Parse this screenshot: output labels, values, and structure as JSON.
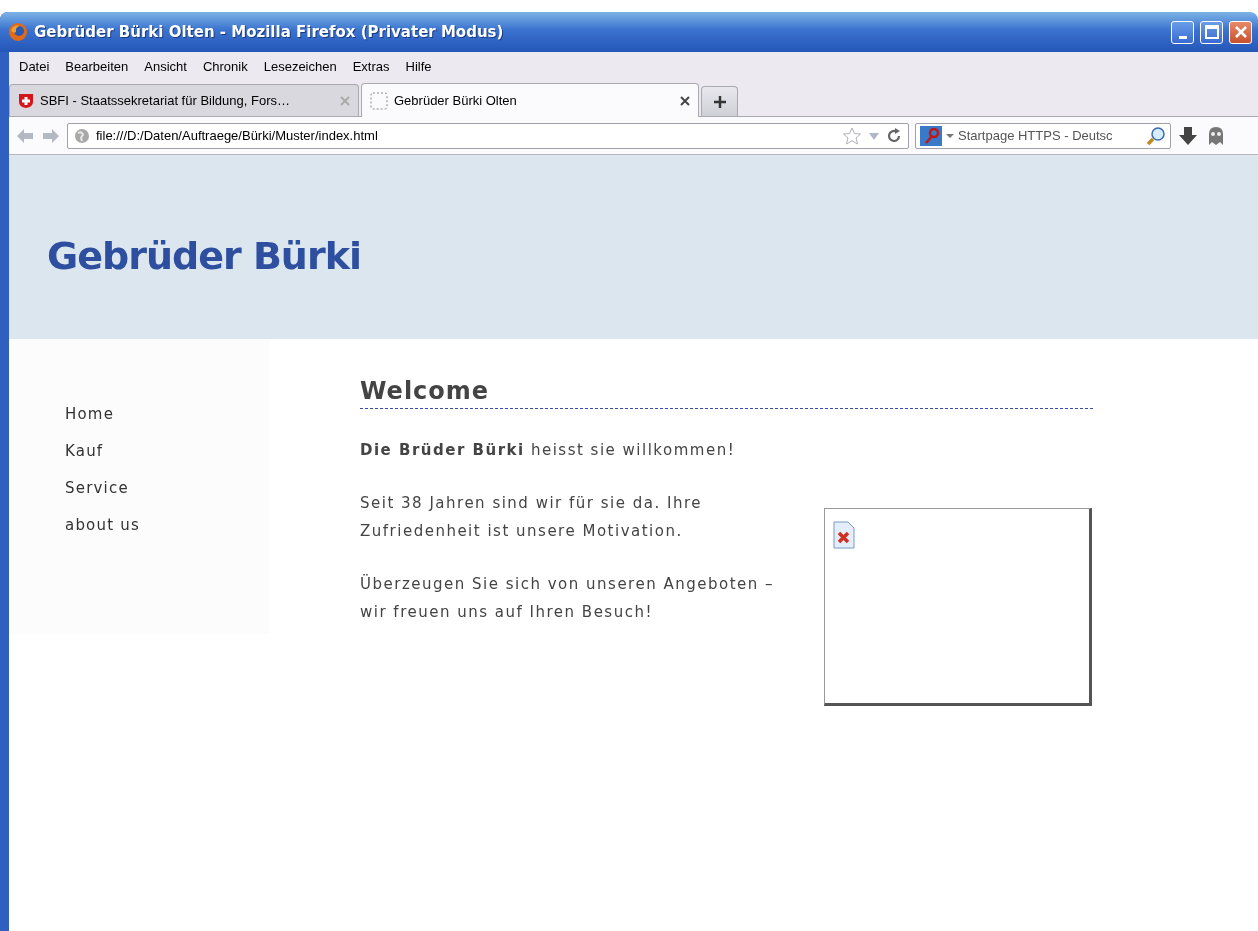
{
  "window": {
    "title": "Gebrüder Bürki Olten - Mozilla Firefox (Privater Modus)"
  },
  "menu": [
    "Datei",
    "Bearbeiten",
    "Ansicht",
    "Chronik",
    "Lesezeichen",
    "Extras",
    "Hilfe"
  ],
  "tabs": [
    {
      "label": "SBFI - Staatssekretariat für Bildung, Fors…",
      "selected": false,
      "kind": "shield"
    },
    {
      "label": "Gebrüder Bürki Olten",
      "selected": true,
      "kind": "blank"
    }
  ],
  "address_bar": {
    "value": "file:///D:/Daten/Auftraege/Bürki/Muster/index.html"
  },
  "search": {
    "placeholder": "Startpage HTTPS - Deutsc"
  },
  "page": {
    "site_title": "Gebrüder Bürki",
    "nav": [
      "Home",
      "Kauf",
      "Service",
      "about us"
    ],
    "heading": "Welcome",
    "paragraphs": [
      "**Die Brüder Bürki** heisst sie willkommen!",
      "Seit 38 Jahren sind wir für sie da. Ihre Zufriedenheit ist unsere Motivation.",
      "Überzeugen Sie sich von unseren Angeboten – wir freuen uns auf Ihren Besuch!"
    ],
    "image": {
      "broken": true
    }
  }
}
